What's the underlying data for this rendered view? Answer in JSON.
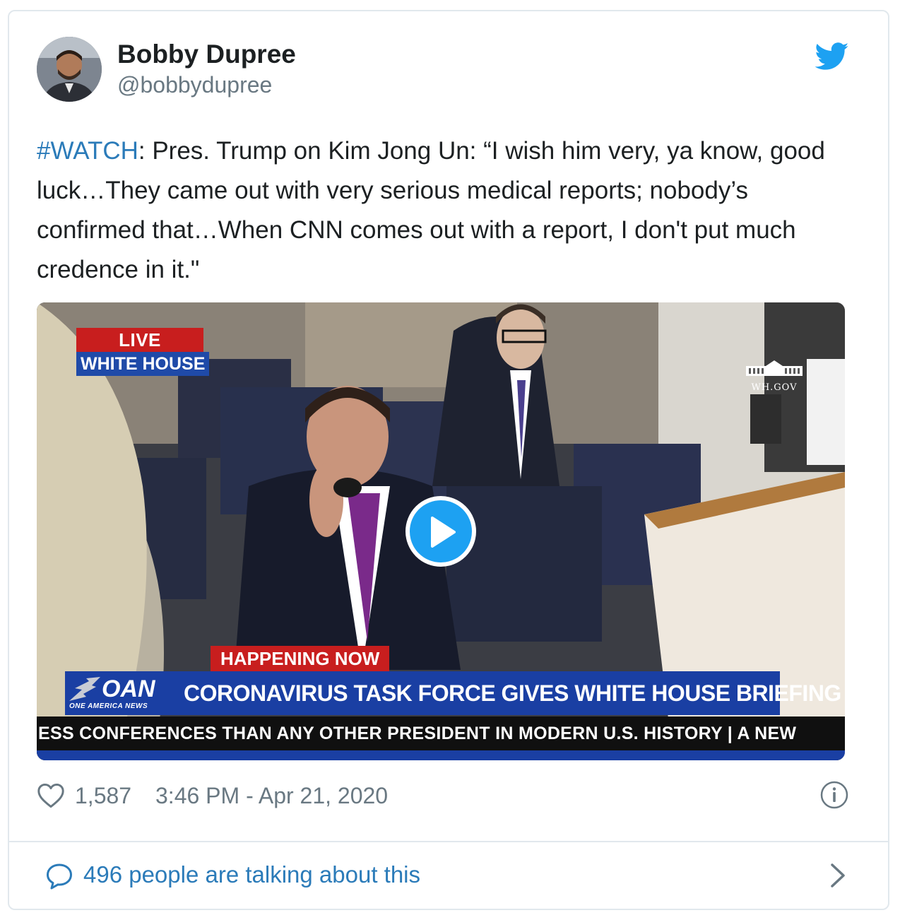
{
  "author": {
    "name": "Bobby Dupree",
    "handle": "@bobbydupree"
  },
  "tweet": {
    "hashtag": "#WATCH",
    "text": ": Pres. Trump on Kim Jong Un: “I wish him very, ya know, good luck…They came out with very serious medical reports; nobody’s confirmed that…When CNN comes out with a report, I don't put much credence in it.\""
  },
  "video": {
    "live_label": "LIVE",
    "location_label": "WHITE HOUSE",
    "wh_logo_text": "WH.GOV",
    "happening_label": "HAPPENING NOW",
    "network_logo": "OAN",
    "network_name": "ONE AMERICA NEWS",
    "headline": "CORONAVIRUS TASK FORCE GIVES WHITE HOUSE BRIEFING",
    "ticker": "ESS CONFERENCES THAN ANY OTHER PRESIDENT IN MODERN U.S. HISTORY  |  A NEW"
  },
  "meta": {
    "like_count": "1,587",
    "timestamp": "3:46 PM - Apr 21, 2020"
  },
  "footer": {
    "talking_text": "496 people are talking about this"
  },
  "colors": {
    "link": "#2b7bb9",
    "twitter_blue": "#1da1f2",
    "muted": "#697882",
    "border": "#e1e8ed"
  },
  "icons": [
    "twitter-bird-icon",
    "play-icon",
    "heart-icon",
    "info-icon",
    "speech-bubble-icon",
    "chevron-right-icon"
  ]
}
